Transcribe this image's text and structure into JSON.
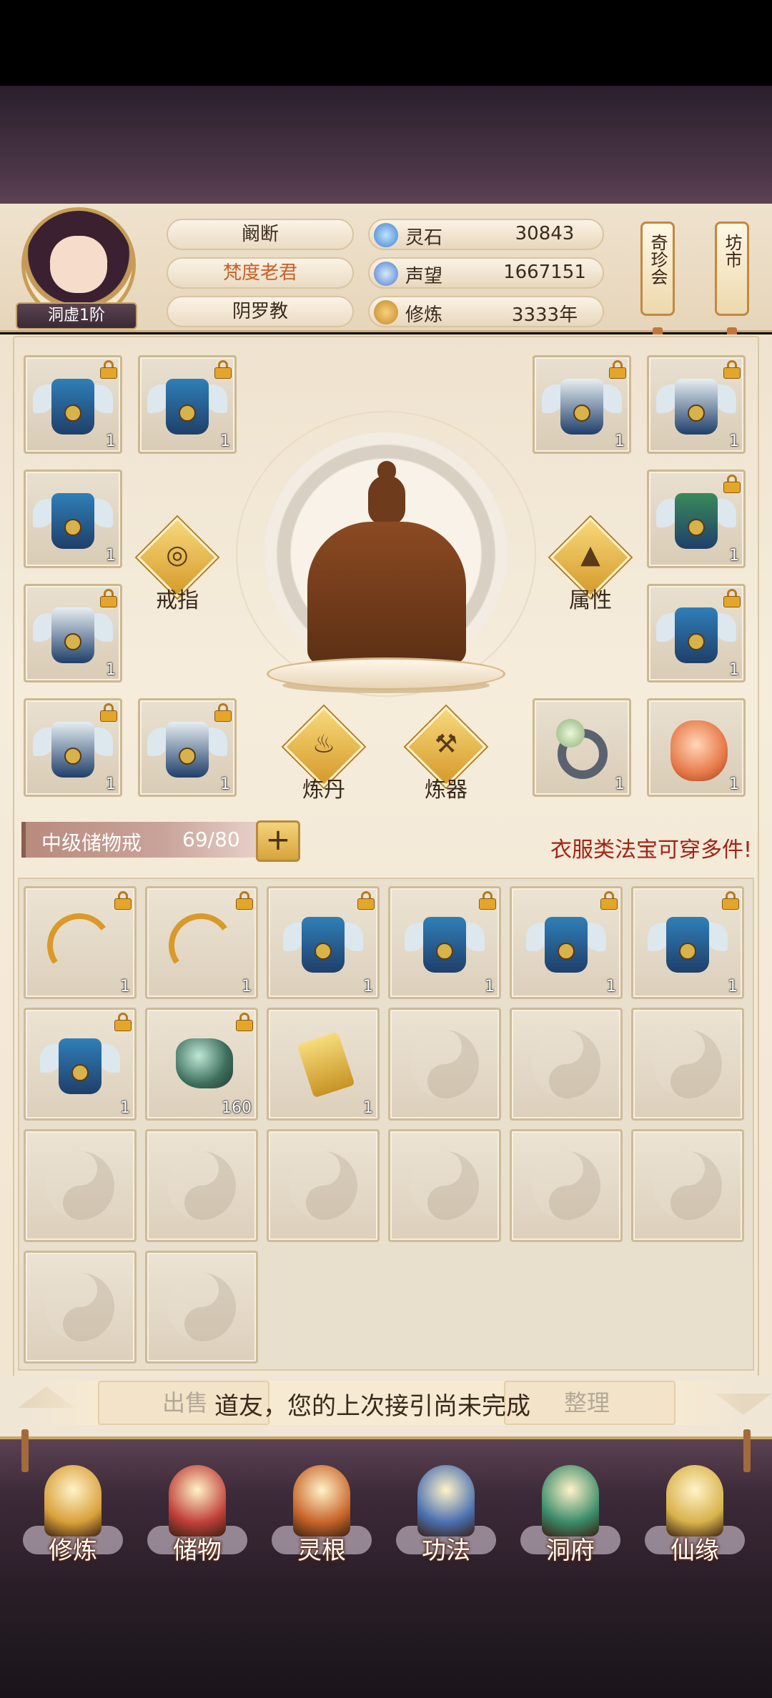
{
  "player": {
    "rank": "洞虚1阶",
    "name": "阚断",
    "title": "梵度老君",
    "sect": "阴罗教"
  },
  "stats": [
    {
      "label": "灵石",
      "value": "30843",
      "icon": "spirit-stone-icon"
    },
    {
      "label": "声望",
      "value": "1667151",
      "icon": "reputation-crystal-icon"
    },
    {
      "label": "修炼",
      "value": "3333年",
      "icon": "meditation-icon"
    }
  ],
  "shops": {
    "treasure": "奇珍会",
    "market": "坊市"
  },
  "equip_actions": {
    "ring": "戒指",
    "attributes": "属性",
    "alchemy": "炼丹",
    "forging": "炼器"
  },
  "equipment_slots": [
    {
      "item": "blue-armor",
      "qty": "1",
      "locked": true
    },
    {
      "item": "blue-armor",
      "qty": "1",
      "locked": true
    },
    {
      "item": "white-fur-armor",
      "qty": "1",
      "locked": true
    },
    {
      "item": "white-fur-armor",
      "qty": "1",
      "locked": true
    },
    {
      "item": "blue-armor",
      "qty": "1",
      "locked": false
    },
    {
      "item": "green-gold-armor",
      "qty": "1",
      "locked": true
    },
    {
      "item": "white-fur-armor",
      "qty": "1",
      "locked": true
    },
    {
      "item": "blue-armor",
      "qty": "1",
      "locked": true
    },
    {
      "item": "white-fur-armor",
      "qty": "1",
      "locked": true
    },
    {
      "item": "white-fur-armor",
      "qty": "1",
      "locked": true
    },
    {
      "item": "jade-ring",
      "qty": "1",
      "locked": false
    },
    {
      "item": "dragon-pendant",
      "qty": "1",
      "locked": false
    }
  ],
  "bag": {
    "name": "中级储物戒",
    "count": "69/80",
    "notice": "衣服类法宝可穿多件!"
  },
  "inventory": [
    {
      "item": "golden-bow",
      "qty": "1",
      "locked": true
    },
    {
      "item": "golden-bow",
      "qty": "1",
      "locked": true
    },
    {
      "item": "blue-armor",
      "qty": "1",
      "locked": true
    },
    {
      "item": "blue-armor",
      "qty": "1",
      "locked": true
    },
    {
      "item": "blue-armor",
      "qty": "1",
      "locked": true
    },
    {
      "item": "blue-armor",
      "qty": "1",
      "locked": true
    },
    {
      "item": "blue-armor",
      "qty": "1",
      "locked": true
    },
    {
      "item": "jade-ore",
      "qty": "160",
      "locked": true
    },
    {
      "item": "golden-scroll",
      "qty": "1",
      "locked": false
    },
    {
      "item": "empty",
      "qty": "",
      "locked": false
    },
    {
      "item": "empty",
      "qty": "",
      "locked": false
    },
    {
      "item": "empty",
      "qty": "",
      "locked": false
    },
    {
      "item": "empty",
      "qty": "",
      "locked": false
    },
    {
      "item": "empty",
      "qty": "",
      "locked": false
    },
    {
      "item": "empty",
      "qty": "",
      "locked": false
    },
    {
      "item": "empty",
      "qty": "",
      "locked": false
    },
    {
      "item": "empty",
      "qty": "",
      "locked": false
    },
    {
      "item": "empty",
      "qty": "",
      "locked": false
    },
    {
      "item": "empty",
      "qty": "",
      "locked": false
    },
    {
      "item": "empty",
      "qty": "",
      "locked": false
    }
  ],
  "actions": {
    "sell": "出售",
    "sort": "整理",
    "message": "道友，您的上次接引尚未完成"
  },
  "nav": [
    {
      "label": "修炼",
      "icon": "cultivator-icon",
      "color": "#d8a03a"
    },
    {
      "label": "储物",
      "icon": "pouch-icon",
      "color": "#c0403a"
    },
    {
      "label": "灵根",
      "icon": "spirit-root-icon",
      "color": "#c8642a"
    },
    {
      "label": "功法",
      "icon": "book-icon",
      "color": "#4a6fb0"
    },
    {
      "label": "洞府",
      "icon": "cave-dwelling-icon",
      "color": "#3a8a6a"
    },
    {
      "label": "仙缘",
      "icon": "gourd-icon",
      "color": "#d8b24a"
    }
  ],
  "colors": {
    "accent_gold": "#d59a2b",
    "notice_red": "#a02418",
    "title_orange": "#c5612a"
  }
}
